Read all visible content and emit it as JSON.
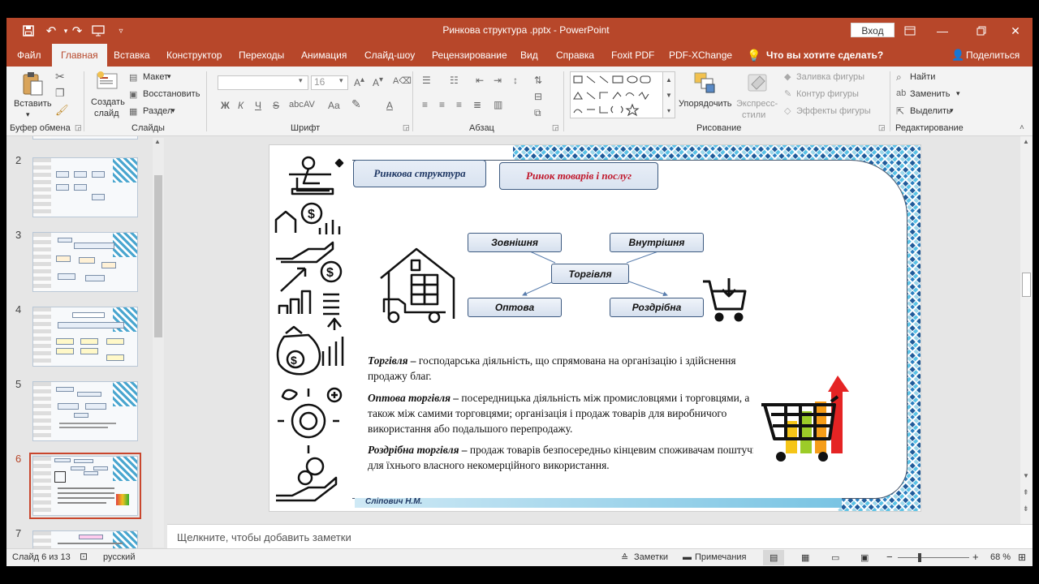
{
  "window": {
    "title": "Ринкова структура .pptx  -  PowerPoint",
    "signin": "Вход"
  },
  "tabs": [
    "Файл",
    "Главная",
    "Вставка",
    "Конструктор",
    "Переходы",
    "Анимация",
    "Слайд-шоу",
    "Рецензирование",
    "Вид",
    "Справка",
    "Foxit PDF",
    "PDF-XChange"
  ],
  "tell_me": "Что вы хотите сделать?",
  "share": "Поделиться",
  "ribbon": {
    "clipboard": {
      "paste": "Вставить",
      "label": "Буфер обмена"
    },
    "slides": {
      "new_slide_1": "Создать",
      "new_slide_2": "слайд",
      "layout": "Макет",
      "reset": "Восстановить",
      "section": "Раздел",
      "label": "Слайды"
    },
    "font": {
      "size": "16",
      "bold": "Ж",
      "italic": "К",
      "underline": "Ч",
      "strike": "S",
      "spacing": "AV",
      "case": "Aa",
      "label": "Шрифт"
    },
    "paragraph": {
      "label": "Абзац"
    },
    "drawing": {
      "arrange": "Упорядочить",
      "quick_styles_1": "Экспресс-",
      "quick_styles_2": "стили",
      "fill": "Заливка фигуры",
      "outline": "Контур фигуры",
      "effects": "Эффекты фигуры",
      "label": "Рисование"
    },
    "editing": {
      "find": "Найти",
      "replace": "Заменить",
      "select": "Выделить",
      "label": "Редактирование"
    }
  },
  "thumbnails": [
    {
      "num": "2"
    },
    {
      "num": "3"
    },
    {
      "num": "4"
    },
    {
      "num": "5"
    },
    {
      "num": "6"
    },
    {
      "num": "7"
    }
  ],
  "slide": {
    "header_left": "Ринкова структура",
    "header_right": "Ринок товарів і послуг",
    "nodes": {
      "external": "Зовнішня",
      "internal": "Внутрішня",
      "trade": "Торгівля",
      "wholesale": "Оптова",
      "retail": "Роздрібна"
    },
    "p1_term": "Торгівля –",
    "p1_text": " господарська діяльність, що спрямована на організацію і здійснення продажу благ.",
    "p2_term": "Оптова торгівля –",
    "p2_text": " посередницька діяльність між промисловцями і торговцями, а також між самими торговцями; організація і продаж товарів для виробничого використання або подальшого  перепродажу.",
    "p3_term": "Роздрібна торгівля –",
    "p3_text": " продаж товарів безпосередньо кінцевим споживачам поштучно для їхнього власного некомерційного використання.",
    "footer": "Сліпович Н.М."
  },
  "notes_placeholder": "Щелкните, чтобы добавить заметки",
  "status": {
    "slide": "Слайд 6 из 13",
    "language": "русский",
    "notes": "Заметки",
    "comments": "Примечания",
    "zoom": "68 %"
  },
  "colors": {
    "accent": "#b7472a",
    "header_right_text": "#c0182c",
    "header_left_text": "#1f3864"
  }
}
